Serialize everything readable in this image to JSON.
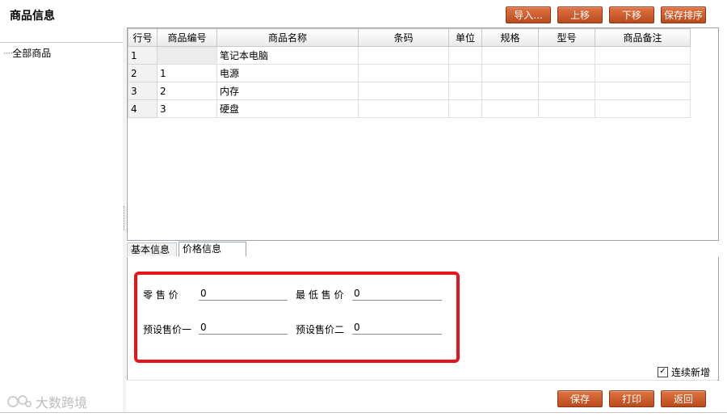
{
  "title": "商品信息",
  "toolbar": {
    "import_label": "导入...",
    "up_label": "上移",
    "down_label": "下移",
    "save_order_label": "保存排序"
  },
  "tree": {
    "root_label": "全部商品"
  },
  "grid": {
    "columns": [
      "行号",
      "商品编号",
      "商品名称",
      "条码",
      "单位",
      "规格",
      "型号",
      "商品备注"
    ],
    "rows": [
      [
        "1",
        "",
        "笔记本电脑",
        "",
        "",
        "",
        "",
        ""
      ],
      [
        "2",
        "1",
        "电源",
        "",
        "",
        "",
        "",
        ""
      ],
      [
        "3",
        "2",
        "内存",
        "",
        "",
        "",
        "",
        ""
      ],
      [
        "4",
        "3",
        "硬盘",
        "",
        "",
        "",
        "",
        ""
      ]
    ]
  },
  "tabs": {
    "basic_label": "基本信息",
    "price_label": "价格信息"
  },
  "price_form": {
    "retail_label": "零 售 价",
    "retail_value": "0",
    "min_label": "最 低 售 价",
    "min_value": "0",
    "preset1_label": "预设售价一",
    "preset1_value": "0",
    "preset2_label": "预设售价二",
    "preset2_value": "0"
  },
  "continuous_add": {
    "label": "连续新增",
    "checked_glyph": "✓"
  },
  "footer": {
    "save_label": "保存",
    "print_label": "打印",
    "back_label": "返回"
  },
  "watermark": {
    "text": "大数跨境"
  },
  "colors": {
    "accent_button": "#c95a2a",
    "highlight_box": "#e8141c"
  }
}
